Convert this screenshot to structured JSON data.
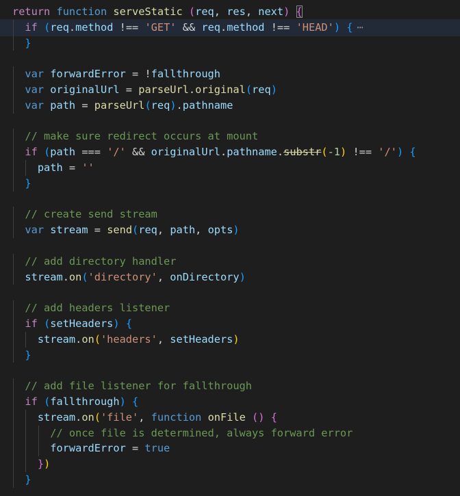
{
  "lines": [
    {
      "indent": 0,
      "current": false,
      "tokens": [
        {
          "t": "return",
          "c": "ctl"
        },
        {
          "t": " "
        },
        {
          "t": "function",
          "c": "kw"
        },
        {
          "t": " "
        },
        {
          "t": "serveStatic",
          "c": "fn"
        },
        {
          "t": " "
        },
        {
          "t": "(",
          "c": "b2"
        },
        {
          "t": "req",
          "c": "var"
        },
        {
          "t": ", "
        },
        {
          "t": "res",
          "c": "var"
        },
        {
          "t": ", "
        },
        {
          "t": "next",
          "c": "var"
        },
        {
          "t": ")",
          "c": "b2"
        },
        {
          "t": " "
        },
        {
          "t": "{",
          "c": "b2",
          "match": true
        }
      ]
    },
    {
      "indent": 1,
      "current": true,
      "fold": "⋯",
      "tokens": [
        {
          "t": "if",
          "c": "ctl"
        },
        {
          "t": " "
        },
        {
          "t": "(",
          "c": "b3"
        },
        {
          "t": "req",
          "c": "var"
        },
        {
          "t": "."
        },
        {
          "t": "method",
          "c": "var"
        },
        {
          "t": " !== "
        },
        {
          "t": "'GET'",
          "c": "str"
        },
        {
          "t": " && "
        },
        {
          "t": "req",
          "c": "var"
        },
        {
          "t": "."
        },
        {
          "t": "method",
          "c": "var"
        },
        {
          "t": " !== "
        },
        {
          "t": "'HEAD'",
          "c": "str"
        },
        {
          "t": ")",
          "c": "b3"
        },
        {
          "t": " "
        },
        {
          "t": "{",
          "c": "b3"
        }
      ]
    },
    {
      "indent": 1,
      "tokens": [
        {
          "t": "}",
          "c": "b3"
        }
      ]
    },
    {
      "indent": 0,
      "tokens": []
    },
    {
      "indent": 1,
      "tokens": [
        {
          "t": "var",
          "c": "kw"
        },
        {
          "t": " "
        },
        {
          "t": "forwardError",
          "c": "var"
        },
        {
          "t": " = !"
        },
        {
          "t": "fallthrough",
          "c": "var"
        }
      ]
    },
    {
      "indent": 1,
      "tokens": [
        {
          "t": "var",
          "c": "kw"
        },
        {
          "t": " "
        },
        {
          "t": "originalUrl",
          "c": "var"
        },
        {
          "t": " = "
        },
        {
          "t": "parseUrl",
          "c": "fn"
        },
        {
          "t": "."
        },
        {
          "t": "original",
          "c": "fn"
        },
        {
          "t": "(",
          "c": "b3"
        },
        {
          "t": "req",
          "c": "var"
        },
        {
          "t": ")",
          "c": "b3"
        }
      ]
    },
    {
      "indent": 1,
      "tokens": [
        {
          "t": "var",
          "c": "kw"
        },
        {
          "t": " "
        },
        {
          "t": "path",
          "c": "var"
        },
        {
          "t": " = "
        },
        {
          "t": "parseUrl",
          "c": "fn"
        },
        {
          "t": "(",
          "c": "b3"
        },
        {
          "t": "req",
          "c": "var"
        },
        {
          "t": ")",
          "c": "b3"
        },
        {
          "t": "."
        },
        {
          "t": "pathname",
          "c": "var"
        }
      ]
    },
    {
      "indent": 0,
      "tokens": []
    },
    {
      "indent": 1,
      "tokens": [
        {
          "t": "// make sure redirect occurs at mount",
          "c": "com"
        }
      ]
    },
    {
      "indent": 1,
      "tokens": [
        {
          "t": "if",
          "c": "ctl"
        },
        {
          "t": " "
        },
        {
          "t": "(",
          "c": "b3"
        },
        {
          "t": "path",
          "c": "var"
        },
        {
          "t": " === "
        },
        {
          "t": "'/'",
          "c": "str"
        },
        {
          "t": " && "
        },
        {
          "t": "originalUrl",
          "c": "var"
        },
        {
          "t": "."
        },
        {
          "t": "pathname",
          "c": "var"
        },
        {
          "t": "."
        },
        {
          "t": "substr",
          "c": "fn",
          "strike": true
        },
        {
          "t": "(",
          "c": "b1"
        },
        {
          "t": "-1",
          "c": "num"
        },
        {
          "t": ")",
          "c": "b1"
        },
        {
          "t": " !== "
        },
        {
          "t": "'/'",
          "c": "str"
        },
        {
          "t": ")",
          "c": "b3"
        },
        {
          "t": " "
        },
        {
          "t": "{",
          "c": "b3"
        }
      ]
    },
    {
      "indent": 2,
      "tokens": [
        {
          "t": "path",
          "c": "var"
        },
        {
          "t": " = "
        },
        {
          "t": "''",
          "c": "str"
        }
      ]
    },
    {
      "indent": 1,
      "tokens": [
        {
          "t": "}",
          "c": "b3"
        }
      ]
    },
    {
      "indent": 0,
      "tokens": []
    },
    {
      "indent": 1,
      "tokens": [
        {
          "t": "// create send stream",
          "c": "com"
        }
      ]
    },
    {
      "indent": 1,
      "tokens": [
        {
          "t": "var",
          "c": "kw"
        },
        {
          "t": " "
        },
        {
          "t": "stream",
          "c": "var"
        },
        {
          "t": " = "
        },
        {
          "t": "send",
          "c": "fn"
        },
        {
          "t": "(",
          "c": "b3"
        },
        {
          "t": "req",
          "c": "var"
        },
        {
          "t": ", "
        },
        {
          "t": "path",
          "c": "var"
        },
        {
          "t": ", "
        },
        {
          "t": "opts",
          "c": "var"
        },
        {
          "t": ")",
          "c": "b3"
        }
      ]
    },
    {
      "indent": 0,
      "tokens": []
    },
    {
      "indent": 1,
      "tokens": [
        {
          "t": "// add directory handler",
          "c": "com"
        }
      ]
    },
    {
      "indent": 1,
      "tokens": [
        {
          "t": "stream",
          "c": "var"
        },
        {
          "t": "."
        },
        {
          "t": "on",
          "c": "fn"
        },
        {
          "t": "(",
          "c": "b3"
        },
        {
          "t": "'directory'",
          "c": "str"
        },
        {
          "t": ", "
        },
        {
          "t": "onDirectory",
          "c": "var"
        },
        {
          "t": ")",
          "c": "b3"
        }
      ]
    },
    {
      "indent": 0,
      "tokens": []
    },
    {
      "indent": 1,
      "tokens": [
        {
          "t": "// add headers listener",
          "c": "com"
        }
      ]
    },
    {
      "indent": 1,
      "tokens": [
        {
          "t": "if",
          "c": "ctl"
        },
        {
          "t": " "
        },
        {
          "t": "(",
          "c": "b3"
        },
        {
          "t": "setHeaders",
          "c": "var"
        },
        {
          "t": ")",
          "c": "b3"
        },
        {
          "t": " "
        },
        {
          "t": "{",
          "c": "b3"
        }
      ]
    },
    {
      "indent": 2,
      "tokens": [
        {
          "t": "stream",
          "c": "var"
        },
        {
          "t": "."
        },
        {
          "t": "on",
          "c": "fn"
        },
        {
          "t": "(",
          "c": "b1"
        },
        {
          "t": "'headers'",
          "c": "str"
        },
        {
          "t": ", "
        },
        {
          "t": "setHeaders",
          "c": "var"
        },
        {
          "t": ")",
          "c": "b1"
        }
      ]
    },
    {
      "indent": 1,
      "tokens": [
        {
          "t": "}",
          "c": "b3"
        }
      ]
    },
    {
      "indent": 0,
      "tokens": []
    },
    {
      "indent": 1,
      "tokens": [
        {
          "t": "// add file listener for fallthrough",
          "c": "com"
        }
      ]
    },
    {
      "indent": 1,
      "tokens": [
        {
          "t": "if",
          "c": "ctl"
        },
        {
          "t": " "
        },
        {
          "t": "(",
          "c": "b3"
        },
        {
          "t": "fallthrough",
          "c": "var"
        },
        {
          "t": ")",
          "c": "b3"
        },
        {
          "t": " "
        },
        {
          "t": "{",
          "c": "b3"
        }
      ]
    },
    {
      "indent": 2,
      "tokens": [
        {
          "t": "stream",
          "c": "var"
        },
        {
          "t": "."
        },
        {
          "t": "on",
          "c": "fn"
        },
        {
          "t": "(",
          "c": "b1"
        },
        {
          "t": "'file'",
          "c": "str"
        },
        {
          "t": ", "
        },
        {
          "t": "function",
          "c": "kw"
        },
        {
          "t": " "
        },
        {
          "t": "onFile",
          "c": "fn"
        },
        {
          "t": " "
        },
        {
          "t": "(",
          "c": "b2"
        },
        {
          "t": ")",
          "c": "b2"
        },
        {
          "t": " "
        },
        {
          "t": "{",
          "c": "b2"
        }
      ]
    },
    {
      "indent": 3,
      "tokens": [
        {
          "t": "// once file is determined, always forward error",
          "c": "com"
        }
      ]
    },
    {
      "indent": 3,
      "tokens": [
        {
          "t": "forwardError",
          "c": "var"
        },
        {
          "t": " = "
        },
        {
          "t": "true",
          "c": "kw"
        }
      ]
    },
    {
      "indent": 2,
      "tokens": [
        {
          "t": "}",
          "c": "b2"
        },
        {
          "t": ")",
          "c": "b1"
        }
      ]
    },
    {
      "indent": 1,
      "tokens": [
        {
          "t": "}",
          "c": "b3"
        }
      ]
    }
  ]
}
